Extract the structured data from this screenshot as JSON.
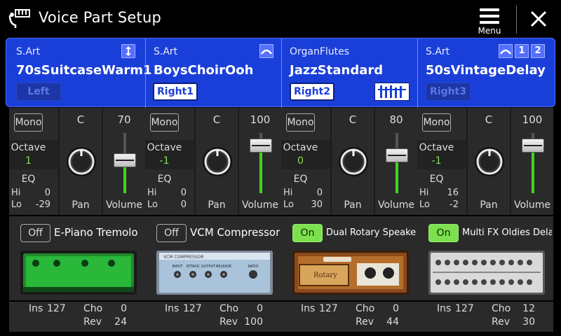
{
  "window": {
    "title": "Voice Part Setup",
    "menu_label": "Menu"
  },
  "parts": [
    {
      "category": "S.Art",
      "voice": "70sSuitcaseWarm1",
      "part": "Left",
      "part_selected": false,
      "header_icon": "split-arrows-icon",
      "mono": "Mono",
      "octave_label": "Octave",
      "octave": "1",
      "eq_label": "EQ",
      "eq_hi": "0",
      "eq_lo": "-29",
      "pan": "C",
      "pan_label": "Pan",
      "volume": "70",
      "volume_label": "Volume",
      "fx_state": "Off",
      "fx_on": false,
      "fx_name": "E-Piano Tremolo",
      "fx_graphic": "green-stomp-pedal",
      "ins": "127",
      "cho": "0",
      "rev": "24",
      "ins_label": "Ins",
      "cho_label": "Cho",
      "rev_label": "Rev"
    },
    {
      "category": "S.Art",
      "voice": "BoysChoirOoh",
      "part": "Right1",
      "part_selected": true,
      "header_icon": "arc-icon",
      "mono": "Mono",
      "octave_label": "Octave",
      "octave": "-1",
      "eq_label": "EQ",
      "eq_hi": "0",
      "eq_lo": "0",
      "pan": "C",
      "pan_label": "Pan",
      "volume": "100",
      "volume_label": "Volume",
      "fx_state": "Off",
      "fx_on": false,
      "fx_name": "VCM Compressor",
      "fx_graphic": "vcm-compressor-unit",
      "fx_graphic_text": [
        "VCM COMPRESSOR",
        "INPUT",
        "ATTACK",
        "OUTPUT",
        "RELEASE",
        "RATIO"
      ],
      "ins": "127",
      "cho": "0",
      "rev": "100",
      "ins_label": "Ins",
      "cho_label": "Cho",
      "rev_label": "Rev"
    },
    {
      "category": "OrganFlutes",
      "voice": "JazzStandard",
      "part": "Right2",
      "part_selected": true,
      "header_icon": "drawbars-icon",
      "mono": "Mono",
      "octave_label": "Octave",
      "octave": "0",
      "eq_label": "EQ",
      "eq_hi": "0",
      "eq_lo": "30",
      "pan": "C",
      "pan_label": "Pan",
      "volume": "80",
      "volume_label": "Volume",
      "fx_state": "On",
      "fx_on": true,
      "fx_name": "Dual Rotary Speaker Br~",
      "fx_graphic": "rotary-speaker-cabinet",
      "fx_graphic_text": [
        "Rotary"
      ],
      "ins": "127",
      "cho": "0",
      "rev": "44",
      "ins_label": "Ins",
      "cho_label": "Cho",
      "rev_label": "Rev"
    },
    {
      "category": "S.Art",
      "voice": "50sVintageDelay",
      "part": "Right3",
      "part_selected": false,
      "header_icon": "arc-icon",
      "header_tags": [
        "1",
        "2"
      ],
      "mono": "Mono",
      "octave_label": "Octave",
      "octave": "-1",
      "eq_label": "EQ",
      "eq_hi": "16",
      "eq_lo": "-2",
      "pan": "C",
      "pan_label": "Pan",
      "volume": "100",
      "volume_label": "Volume",
      "fx_state": "On",
      "fx_on": true,
      "fx_name": "Multi FX Oldies Delay",
      "fx_graphic": "multi-fx-rack",
      "ins": "127",
      "cho": "12",
      "rev": "30",
      "ins_label": "Ins",
      "cho_label": "Cho",
      "rev_label": "Rev"
    }
  ],
  "colors": {
    "header_blue": "#1a3fd9",
    "level_green": "#3ed61e",
    "fx_on_green": "#7de04f"
  }
}
